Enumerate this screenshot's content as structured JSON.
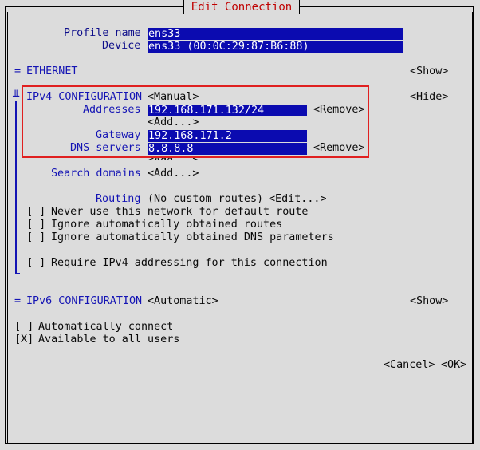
{
  "window": {
    "title": "Edit Connection"
  },
  "profile": {
    "name_label": "Profile name",
    "name_value": "ens33",
    "device_label": "Device",
    "device_value": "ens33 (00:0C:29:87:B6:88)"
  },
  "ethernet": {
    "marker": "=",
    "label": "ETHERNET",
    "toggle": "<Show>"
  },
  "ipv4": {
    "marker": "╨",
    "label": "IPv4 CONFIGURATION",
    "mode": "<Manual>",
    "toggle": "<Hide>",
    "addresses_label": "Addresses",
    "address_value": "192.168.171.132/24",
    "remove_label": "<Remove>",
    "add_label": "<Add...>",
    "gateway_label": "Gateway",
    "gateway_value": "192.168.171.2",
    "dns_label": "DNS servers",
    "dns_value": "8.8.8.8",
    "search_label": "Search domains",
    "routing_label": "Routing",
    "routing_value": "(No custom routes)",
    "routing_edit": "<Edit...>",
    "checkboxes": [
      {
        "box": "[ ]",
        "label": "Never use this network for default route"
      },
      {
        "box": "[ ]",
        "label": "Ignore automatically obtained routes"
      },
      {
        "box": "[ ]",
        "label": "Ignore automatically obtained DNS parameters"
      },
      {
        "box": "[ ]",
        "label": "Require IPv4 addressing for this connection"
      }
    ]
  },
  "ipv6": {
    "marker": "=",
    "label": "IPv6 CONFIGURATION",
    "mode": "<Automatic>",
    "toggle": "<Show>"
  },
  "options": [
    {
      "box": "[ ]",
      "label": "Automatically connect"
    },
    {
      "box": "[X]",
      "label": "Available to all users"
    }
  ],
  "buttons": {
    "cancel": "<Cancel>",
    "ok": "<OK>"
  },
  "colors": {
    "field_bg": "#0b0bb0",
    "label": "#1414b4",
    "title": "#c00000",
    "highlight": "#e02020",
    "background": "#dcdcdc"
  }
}
